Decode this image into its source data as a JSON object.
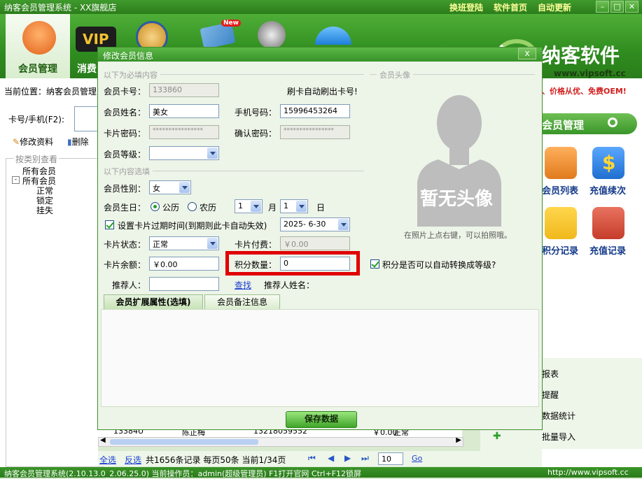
{
  "window": {
    "title": "纳客会员管理系统 - XX旗舰店",
    "links": [
      "换班登陆",
      "软件首页",
      "自动更新"
    ]
  },
  "toolbar": {
    "items": [
      {
        "label": "会员管理"
      },
      {
        "label": "消费"
      },
      {
        "label": ""
      },
      {
        "label": ""
      },
      {
        "label": ""
      },
      {
        "label": ""
      }
    ],
    "new_badge": "New",
    "vip_badge": "VIP"
  },
  "brand": {
    "name": "纳客软件",
    "url": "www.vipsoft.cc"
  },
  "location": {
    "text": "当前位置：纳客会员管理"
  },
  "left": {
    "search_label": "卡号/手机(F2):",
    "edit_btn": "修改资料",
    "delete_btn": "删除",
    "category_title": "按类别查看",
    "tree": [
      "所有会员",
      "所有会员",
      "正常",
      "锁定",
      "挂失"
    ]
  },
  "right": {
    "marquee": "、价格从优、免费OEM!",
    "section_title": "会员管理",
    "icons": [
      {
        "label": "会员列表",
        "color": "#e07b1d"
      },
      {
        "label": "充值续次",
        "color": "#1f6fd1"
      },
      {
        "label": "积分记录",
        "color": "#f0b81c"
      },
      {
        "label": "充值记录",
        "color": "#c63c2b"
      }
    ],
    "links": [
      "报表",
      "提醒",
      "数据统计",
      "会员数据批量导入"
    ]
  },
  "table": {
    "row": [
      "13384U",
      "陈正梅",
      "13218059552",
      "￥0.00",
      "正常"
    ]
  },
  "pager": {
    "select_all": "全选",
    "invert": "反选",
    "summary": "共1656条记录  每页50条  当前1/34页",
    "page_input": "10",
    "go": "Go"
  },
  "status": {
    "left": "纳客会员管理系统(2.10.13.0_2.06.25.0)  当前操作员：admin(超级管理员)  F1打开官网 Ctrl+F12锁屏",
    "right": "http://www.vipsoft.cc"
  },
  "dialog": {
    "title": "修改会员信息",
    "section_required": "以下为必填内容",
    "section_optional": "以下内容选填",
    "section_avatar": "会员头像",
    "card_no": {
      "label": "会员卡号：",
      "value": "133860"
    },
    "swipe_hint": "刷卡自动刷出卡号!",
    "name": {
      "label": "会员姓名：",
      "value": "美女"
    },
    "phone": {
      "label": "手机号码：",
      "value": "15996453264"
    },
    "password": {
      "label": "卡片密码：",
      "value": "****************"
    },
    "confirm_password": {
      "label": "确认密码：",
      "value": "****************"
    },
    "level": {
      "label": "会员等级：",
      "value": ""
    },
    "gender": {
      "label": "会员性别：",
      "value": "女"
    },
    "birthday": {
      "label": "会员生日：",
      "solar": "公历",
      "lunar": "农历",
      "month": "1",
      "month_unit": "月",
      "day": "1",
      "day_unit": "日"
    },
    "expiry": {
      "label": "设置卡片过期时间(到期则此卡自动失效)",
      "value": "2025- 6-30"
    },
    "card_status": {
      "label": "卡片状态：",
      "value": "正常"
    },
    "card_fee": {
      "label": "卡片付费：",
      "value": "￥0.00"
    },
    "balance": {
      "label": "卡片余额：",
      "value": "￥0.00"
    },
    "points": {
      "label": "积分数量：",
      "value": "0"
    },
    "auto_upgrade": "积分是否可以自动转换成等级?",
    "referrer": {
      "label": "推荐人：",
      "value": ""
    },
    "search": "查找",
    "referrer_name": {
      "label": "推荐人姓名："
    },
    "avatar_placeholder": "暂无头像",
    "avatar_hint": "在照片上点右键，可以拍照哦。",
    "tabs": [
      "会员扩展属性(选填)",
      "会员备注信息"
    ],
    "save": "保存数据",
    "close": "x"
  },
  "colors": {
    "highlight": "#e00000",
    "brand_green": "#3f9a2c"
  }
}
